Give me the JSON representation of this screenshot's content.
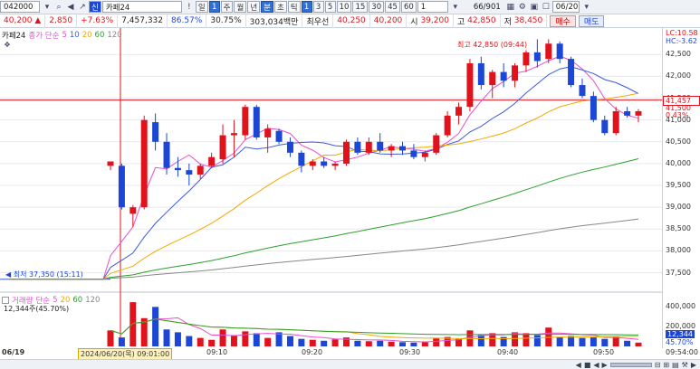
{
  "toolbar": {
    "code": "042000",
    "name": "카페24",
    "tag": "신",
    "period_buttons": [
      "일",
      "1",
      "주",
      "월",
      "년",
      "분",
      "초",
      "틱"
    ],
    "minute_buttons": [
      "1",
      "3",
      "5",
      "10",
      "15",
      "30",
      "45",
      "60"
    ],
    "interval": "1",
    "count": "66/901",
    "date": "06/20"
  },
  "quote": {
    "price": "40,200",
    "arrow": "▲",
    "change": "2,850",
    "change_pct": "+7.63%",
    "volume": "7,457,332",
    "ratio1": "86.57%",
    "ratio2": "30.75%",
    "amount": "303,034백만",
    "preferred_label": "최우선",
    "bid1": "40,250",
    "bid2": "40,200",
    "open_label": "시",
    "open": "39,200",
    "high_label": "고",
    "high": "42,850",
    "low_label": "저",
    "low": "38,450",
    "buy": "매수",
    "sell": "매도"
  },
  "legend": {
    "title": "카페24",
    "ma_label": "종가 단순",
    "mas": [
      "5",
      "10",
      "20",
      "60",
      "120"
    ],
    "ma_colors": [
      "#e64fd0",
      "#3b5bdb",
      "#f2a900",
      "#2ca02c",
      "#888888"
    ]
  },
  "axis": {
    "lc": "LC:10.58",
    "hc": "HC:-3.62",
    "ticks": [
      "42,500",
      "42,000",
      "41,500",
      "41,000",
      "40,500",
      "40,000",
      "39,500",
      "39,000",
      "38,500",
      "38,000",
      "37,500"
    ],
    "current": "41,457",
    "current2": "41,500",
    "current_pct": "0.43%"
  },
  "annotations": {
    "high": "최고 42,850 (09:44)",
    "low": "최저 37,350 (15:11)"
  },
  "volume_pane": {
    "title": "거래량",
    "ma_label": "단순",
    "mas": [
      "5",
      "20",
      "60",
      "120"
    ],
    "value": "12,344주(45.70%)",
    "ticks": [
      "400,000",
      "200,000"
    ],
    "current": "12,344",
    "current_pct": "45.70%"
  },
  "xaxis": {
    "left_date": "06/19",
    "cursor_label": "2024/06/20(목) 09:01:00",
    "ticks": [
      "09:10",
      "09:20",
      "09:30",
      "09:40",
      "09:50"
    ],
    "right_label": "09:54:00"
  },
  "colors": {
    "up": "#e0131d",
    "down": "#1c46d6",
    "grid": "#e6e9ef"
  },
  "chart_data": {
    "type": "candlestick",
    "ylim": [
      37200,
      42900
    ],
    "candles": [
      {
        "o": 39950,
        "h": 40050,
        "l": 39850,
        "c": 40050
      },
      {
        "o": 39950,
        "h": 40000,
        "l": 38950,
        "c": 39000
      },
      {
        "o": 38850,
        "h": 39050,
        "l": 38550,
        "c": 39000
      },
      {
        "o": 39000,
        "h": 41100,
        "l": 38950,
        "c": 41000
      },
      {
        "o": 40950,
        "h": 41150,
        "l": 40300,
        "c": 40500
      },
      {
        "o": 40500,
        "h": 40700,
        "l": 39750,
        "c": 39900
      },
      {
        "o": 39900,
        "h": 40150,
        "l": 39700,
        "c": 39850
      },
      {
        "o": 39850,
        "h": 40000,
        "l": 39500,
        "c": 39750
      },
      {
        "o": 39750,
        "h": 40000,
        "l": 39650,
        "c": 39950
      },
      {
        "o": 39950,
        "h": 40250,
        "l": 39900,
        "c": 40150
      },
      {
        "o": 40100,
        "h": 40900,
        "l": 40000,
        "c": 40650
      },
      {
        "o": 40650,
        "h": 41000,
        "l": 40150,
        "c": 40700
      },
      {
        "o": 40650,
        "h": 41350,
        "l": 40550,
        "c": 41300
      },
      {
        "o": 41300,
        "h": 41350,
        "l": 40550,
        "c": 40600
      },
      {
        "o": 40600,
        "h": 40900,
        "l": 40250,
        "c": 40800
      },
      {
        "o": 40750,
        "h": 40800,
        "l": 40450,
        "c": 40500
      },
      {
        "o": 40500,
        "h": 40600,
        "l": 40150,
        "c": 40250
      },
      {
        "o": 40250,
        "h": 40300,
        "l": 39800,
        "c": 39950
      },
      {
        "o": 39950,
        "h": 40100,
        "l": 39850,
        "c": 40050
      },
      {
        "o": 40050,
        "h": 40150,
        "l": 39900,
        "c": 39950
      },
      {
        "o": 39950,
        "h": 40050,
        "l": 39850,
        "c": 40000
      },
      {
        "o": 40000,
        "h": 40550,
        "l": 39950,
        "c": 40500
      },
      {
        "o": 40500,
        "h": 40600,
        "l": 40200,
        "c": 40250
      },
      {
        "o": 40250,
        "h": 40600,
        "l": 40200,
        "c": 40500
      },
      {
        "o": 40500,
        "h": 40700,
        "l": 40250,
        "c": 40300
      },
      {
        "o": 40300,
        "h": 40450,
        "l": 40150,
        "c": 40400
      },
      {
        "o": 40400,
        "h": 40500,
        "l": 40200,
        "c": 40300
      },
      {
        "o": 40300,
        "h": 40450,
        "l": 40100,
        "c": 40150
      },
      {
        "o": 40150,
        "h": 40300,
        "l": 40050,
        "c": 40250
      },
      {
        "o": 40250,
        "h": 40700,
        "l": 40200,
        "c": 40650
      },
      {
        "o": 40650,
        "h": 41200,
        "l": 40600,
        "c": 41100
      },
      {
        "o": 41100,
        "h": 41400,
        "l": 40900,
        "c": 41300
      },
      {
        "o": 41300,
        "h": 42400,
        "l": 41200,
        "c": 42300
      },
      {
        "o": 42300,
        "h": 42450,
        "l": 41700,
        "c": 41800
      },
      {
        "o": 41800,
        "h": 42150,
        "l": 41500,
        "c": 42100
      },
      {
        "o": 42100,
        "h": 42300,
        "l": 41750,
        "c": 41900
      },
      {
        "o": 41900,
        "h": 42300,
        "l": 41750,
        "c": 42250
      },
      {
        "o": 42250,
        "h": 42600,
        "l": 42100,
        "c": 42550
      },
      {
        "o": 42550,
        "h": 42850,
        "l": 42200,
        "c": 42350
      },
      {
        "o": 42400,
        "h": 42850,
        "l": 42300,
        "c": 42750
      },
      {
        "o": 42750,
        "h": 42800,
        "l": 42300,
        "c": 42400
      },
      {
        "o": 42400,
        "h": 42450,
        "l": 41750,
        "c": 41800
      },
      {
        "o": 41800,
        "h": 41950,
        "l": 41500,
        "c": 41550
      },
      {
        "o": 41550,
        "h": 41650,
        "l": 40950,
        "c": 41000
      },
      {
        "o": 41000,
        "h": 41100,
        "l": 40650,
        "c": 40700
      },
      {
        "o": 40700,
        "h": 41300,
        "l": 40650,
        "c": 41200
      },
      {
        "o": 41200,
        "h": 41300,
        "l": 41050,
        "c": 41100
      },
      {
        "o": 41100,
        "h": 41250,
        "l": 40950,
        "c": 41200
      }
    ],
    "volume_ylim": [
      0,
      500000
    ],
    "volume": [
      170000,
      95000,
      470000,
      300000,
      420000,
      180000,
      150000,
      110000,
      90000,
      70000,
      180000,
      120000,
      160000,
      140000,
      90000,
      150000,
      110000,
      80000,
      70000,
      60000,
      75000,
      95000,
      60000,
      55000,
      60000,
      50000,
      45000,
      40000,
      45000,
      90000,
      100000,
      80000,
      170000,
      120000,
      140000,
      100000,
      150000,
      140000,
      120000,
      200000,
      100000,
      110000,
      90000,
      95000,
      80000,
      100000,
      60000,
      40000
    ]
  }
}
